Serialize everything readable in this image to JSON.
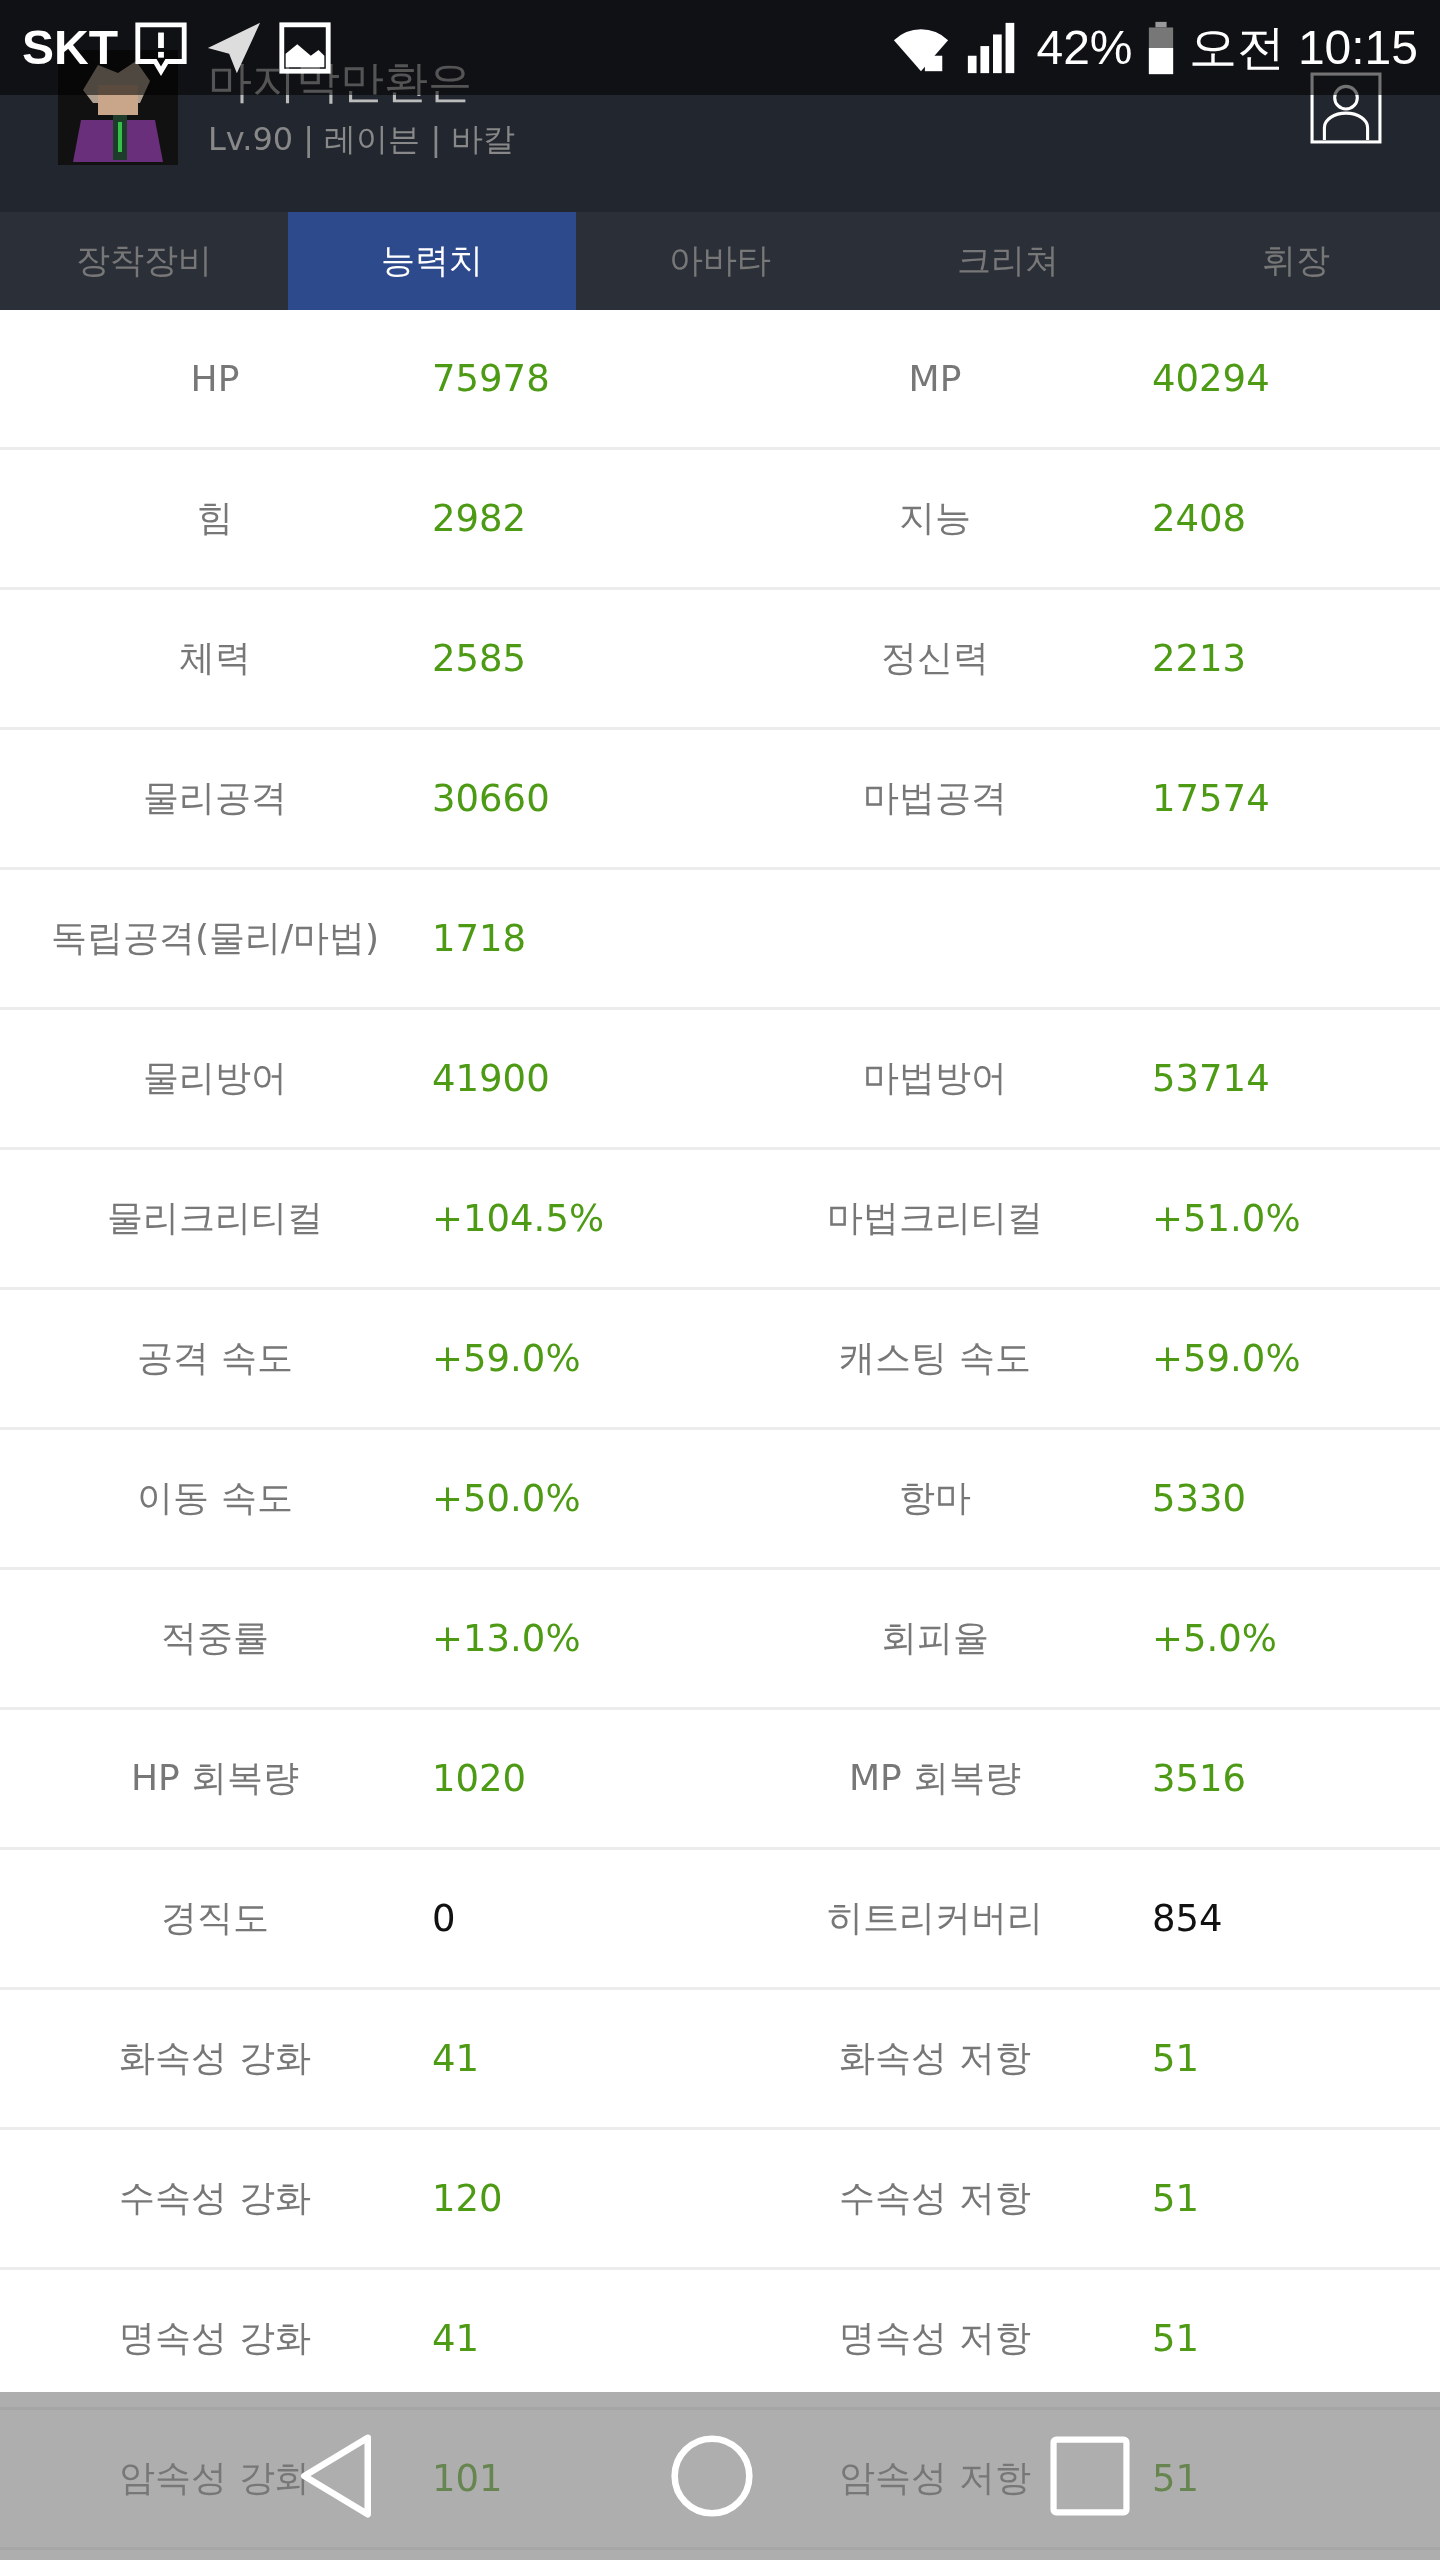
{
  "status_bar": {
    "carrier": "SKT",
    "battery": "42%",
    "time": "오전 10:15"
  },
  "profile": {
    "name": "마지막만환은",
    "subtitle": "Lv.90 | 레이븐 | 바칼"
  },
  "tabs": [
    {
      "label": "장착장비",
      "selected": false
    },
    {
      "label": "능력치",
      "selected": true
    },
    {
      "label": "아바타",
      "selected": false
    },
    {
      "label": "크리쳐",
      "selected": false
    },
    {
      "label": "휘장",
      "selected": false
    }
  ],
  "stats": [
    {
      "cells": [
        {
          "label": "HP",
          "value": "75978",
          "kind": "green"
        },
        {
          "label": "MP",
          "value": "40294",
          "kind": "green"
        }
      ]
    },
    {
      "cells": [
        {
          "label": "힘",
          "value": "2982",
          "kind": "green"
        },
        {
          "label": "지능",
          "value": "2408",
          "kind": "green"
        }
      ]
    },
    {
      "cells": [
        {
          "label": "체력",
          "value": "2585",
          "kind": "green"
        },
        {
          "label": "정신력",
          "value": "2213",
          "kind": "green"
        }
      ]
    },
    {
      "cells": [
        {
          "label": "물리공격",
          "value": "30660",
          "kind": "green"
        },
        {
          "label": "마법공격",
          "value": "17574",
          "kind": "green"
        }
      ]
    },
    {
      "cells": [
        {
          "label": "독립공격(물리/마법)",
          "value": "1718",
          "kind": "green"
        }
      ]
    },
    {
      "cells": [
        {
          "label": "물리방어",
          "value": "41900",
          "kind": "green"
        },
        {
          "label": "마법방어",
          "value": "53714",
          "kind": "green"
        }
      ]
    },
    {
      "cells": [
        {
          "label": "물리크리티컬",
          "value": "+104.5%",
          "kind": "green"
        },
        {
          "label": "마법크리티컬",
          "value": "+51.0%",
          "kind": "green"
        }
      ]
    },
    {
      "cells": [
        {
          "label": "공격 속도",
          "value": "+59.0%",
          "kind": "green"
        },
        {
          "label": "캐스팅 속도",
          "value": "+59.0%",
          "kind": "green"
        }
      ]
    },
    {
      "cells": [
        {
          "label": "이동 속도",
          "value": "+50.0%",
          "kind": "green"
        },
        {
          "label": "항마",
          "value": "5330",
          "kind": "green"
        }
      ]
    },
    {
      "cells": [
        {
          "label": "적중률",
          "value": "+13.0%",
          "kind": "green"
        },
        {
          "label": "회피율",
          "value": "+5.0%",
          "kind": "green"
        }
      ]
    },
    {
      "cells": [
        {
          "label": "HP 회복량",
          "value": "1020",
          "kind": "green"
        },
        {
          "label": "MP 회복량",
          "value": "3516",
          "kind": "green"
        }
      ]
    },
    {
      "cells": [
        {
          "label": "경직도",
          "value": "0",
          "kind": "plain"
        },
        {
          "label": "히트리커버리",
          "value": "854",
          "kind": "plain"
        }
      ]
    },
    {
      "cells": [
        {
          "label": "화속성 강화",
          "value": "41",
          "kind": "green"
        },
        {
          "label": "화속성 저항",
          "value": "51",
          "kind": "green"
        }
      ]
    },
    {
      "cells": [
        {
          "label": "수속성 강화",
          "value": "120",
          "kind": "green"
        },
        {
          "label": "수속성 저항",
          "value": "51",
          "kind": "green"
        }
      ]
    },
    {
      "cells": [
        {
          "label": "명속성 강화",
          "value": "41",
          "kind": "green"
        },
        {
          "label": "명속성 저항",
          "value": "51",
          "kind": "green"
        }
      ]
    },
    {
      "cells": [
        {
          "label": "암속성 강화",
          "value": "101",
          "kind": "green"
        },
        {
          "label": "암속성 저항",
          "value": "51",
          "kind": "green"
        }
      ]
    }
  ]
}
